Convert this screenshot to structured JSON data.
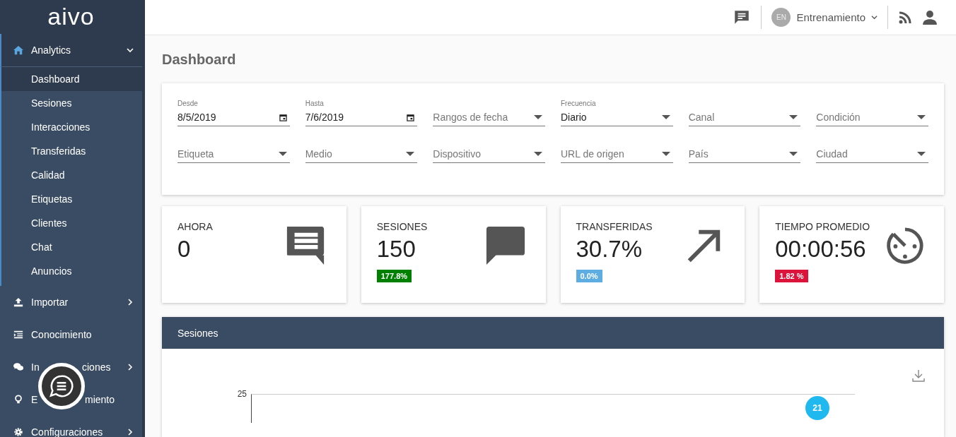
{
  "sidebar": {
    "logo": "aivo",
    "items": [
      {
        "label": "Analytics",
        "has_submenu": true,
        "expanded": true,
        "children": [
          {
            "label": "Dashboard",
            "selected": true
          },
          {
            "label": "Sesiones",
            "selected": false
          },
          {
            "label": "Interacciones",
            "selected": false
          },
          {
            "label": "Transferidas",
            "selected": false
          },
          {
            "label": "Calidad",
            "selected": false
          },
          {
            "label": "Etiquetas",
            "selected": false
          },
          {
            "label": "Clientes",
            "selected": false
          },
          {
            "label": "Chat",
            "selected": false
          },
          {
            "label": "Anuncios",
            "selected": false
          }
        ]
      },
      {
        "label": "Importar",
        "has_submenu": true,
        "expanded": false
      },
      {
        "label": "Conocimiento",
        "has_submenu": false,
        "expanded": false
      },
      {
        "label_parts": [
          "In",
          "ciones"
        ],
        "has_submenu": true,
        "expanded": false
      },
      {
        "label_parts": [
          "E",
          "miento"
        ],
        "has_submenu": false,
        "expanded": false
      },
      {
        "label": "Configuraciones",
        "has_submenu": true,
        "expanded": false
      }
    ]
  },
  "topbar": {
    "avatar": "EN",
    "account": "Entrenamiento"
  },
  "page_title": "Dashboard",
  "filters": [
    {
      "kind": "date",
      "label": "Desde",
      "value": "8/5/2019"
    },
    {
      "kind": "date",
      "label": "Hasta",
      "value": "7/6/2019"
    },
    {
      "kind": "select",
      "placeholder": "Rangos de fecha"
    },
    {
      "kind": "select",
      "label": "Frecuencia",
      "value": "Diario"
    },
    {
      "kind": "select",
      "placeholder": "Canal"
    },
    {
      "kind": "select",
      "placeholder": "Condición"
    },
    {
      "kind": "select",
      "placeholder": "Etiqueta"
    },
    {
      "kind": "select",
      "placeholder": "Medio"
    },
    {
      "kind": "select",
      "placeholder": "Dispositivo"
    },
    {
      "kind": "select",
      "placeholder": "URL de origen"
    },
    {
      "kind": "select",
      "placeholder": "País"
    },
    {
      "kind": "select",
      "placeholder": "Ciudad"
    }
  ],
  "stats": [
    {
      "title": "AHORA",
      "value": "0"
    },
    {
      "title": "SESIONES",
      "value": "150",
      "badge": "177.8%",
      "color": "#008000"
    },
    {
      "title": "TRANSFERIDAS",
      "value": "30.7%",
      "badge": "0.0%",
      "color": "#5dade2"
    },
    {
      "title": "TIEMPO PROMEDIO",
      "value": "00:00:56",
      "badge": "1.82 %",
      "color": "#dc143c"
    }
  ],
  "sessions_panel": {
    "title": "Sesiones",
    "y_tick": "25",
    "point_label": "21"
  }
}
